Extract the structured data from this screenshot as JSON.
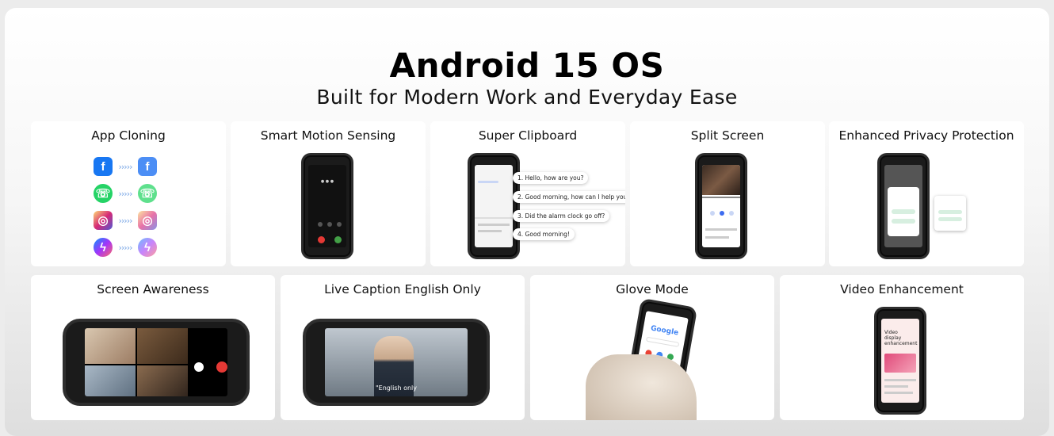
{
  "header": {
    "title": "Android 15 OS",
    "subtitle": "Built for Modern Work and Everyday Ease"
  },
  "features": {
    "app_cloning": "App Cloning",
    "smart_motion": "Smart Motion Sensing",
    "super_clipboard": "Super Clipboard",
    "split_screen": "Split Screen",
    "privacy": "Enhanced Privacy Protection",
    "screen_awareness": "Screen Awareness",
    "live_caption": "Live Caption English Only",
    "glove_mode": "Glove Mode",
    "video_enhancement": "Video Enhancement"
  },
  "clipboard_bubbles": [
    "1. Hello, how are you?",
    "2. Good morning, how can I help you?",
    "3. Did the alarm clock go off?",
    "4. Good morning!"
  ],
  "caption_overlay": "\"English only",
  "video_screen_title": "Video display enhancement",
  "google_logo": "Google",
  "colors": {
    "facebook": "#1877f2",
    "whatsapp": "#25d366",
    "instagram": "#d6249f",
    "messenger": "#a334fa",
    "call_red": "#e53935",
    "call_green": "#43a047",
    "arrow_blue": "#7aa7e6"
  },
  "icons": [
    "facebook-icon",
    "whatsapp-icon",
    "instagram-icon",
    "messenger-icon"
  ]
}
